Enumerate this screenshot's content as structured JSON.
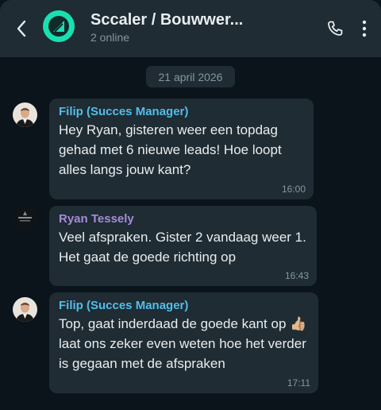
{
  "header": {
    "title": "Sccaler / Bouwwer...",
    "subtitle": "2 online"
  },
  "date_separator": "21 april 2026",
  "messages": [
    {
      "sender": "Filip (Succes Manager)",
      "sender_color": "#53bdeb",
      "text": "Hey Ryan, gisteren weer een topdag gehad met 6 nieuwe leads! Hoe loopt alles langs jouw kant?",
      "time": "16:00"
    },
    {
      "sender": "Ryan Tessely",
      "sender_color": "#a78bdb",
      "text": "Veel afspraken. Gister 2 vandaag weer 1. Het gaat de goede richting op",
      "time": "16:43"
    },
    {
      "sender": "Filip (Succes Manager)",
      "sender_color": "#53bdeb",
      "text": "Top, gaat inderdaad de goede kant op 👍🏼 laat ons zeker even weten hoe het verder is gegaan met de afspraken",
      "time": "17:11"
    }
  ],
  "icons": {
    "back": "chevron-left-icon",
    "group_avatar": "sccaler-logo-icon",
    "phone": "phone-icon",
    "menu": "more-vertical-icon"
  }
}
